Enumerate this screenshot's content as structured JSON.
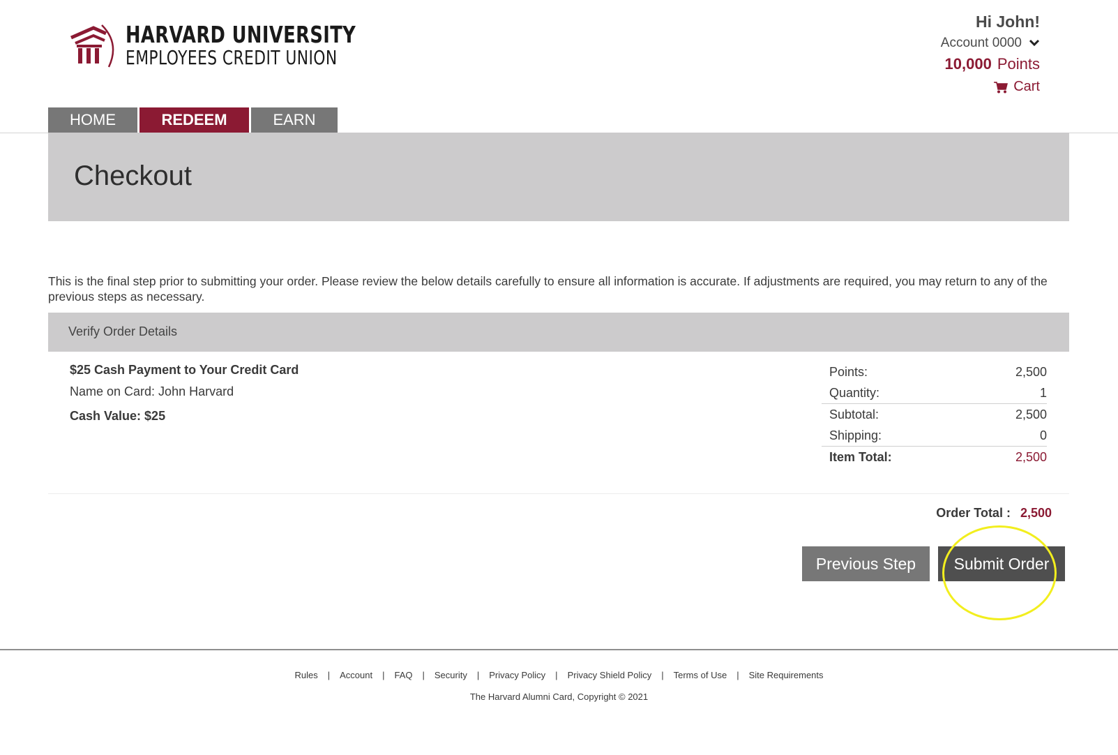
{
  "brand": {
    "line1": "HARVARD UNIVERSITY",
    "line2": "EMPLOYEES CREDIT UNION",
    "color": "#8b1a33"
  },
  "user": {
    "greeting": "Hi John!",
    "account_label": "Account 0000",
    "points_value": "10,000",
    "points_label": "Points",
    "cart_label": "Cart"
  },
  "nav": {
    "tabs": [
      {
        "label": "HOME",
        "active": false
      },
      {
        "label": "REDEEM",
        "active": true
      },
      {
        "label": "EARN",
        "active": false
      }
    ]
  },
  "page": {
    "title": "Checkout",
    "intro": "This is the final step prior to submitting your order. Please review the below details carefully to ensure all information is accurate. If adjustments are required, you may return to any of the previous steps as necessary."
  },
  "verify": {
    "header": "Verify Order Details",
    "item": {
      "title": "$25 Cash Payment to Your Credit Card",
      "name_on_card": "Name on Card: John Harvard",
      "cash_value": "Cash Value: $25"
    },
    "summary": [
      {
        "label": "Points:",
        "value": "2,500"
      },
      {
        "label": "Quantity:",
        "value": "1"
      },
      {
        "label": "Subtotal:",
        "value": "2,500"
      },
      {
        "label": "Shipping:",
        "value": "0"
      },
      {
        "label": "Item Total:",
        "value": "2,500"
      }
    ]
  },
  "order_total": {
    "label": "Order Total :",
    "value": "2,500"
  },
  "actions": {
    "previous_label": "Previous Step",
    "submit_label": "Submit Order"
  },
  "footer": {
    "links": [
      "Rules",
      "Account",
      "FAQ",
      "Security",
      "Privacy Policy",
      "Privacy Shield Policy",
      "Terms of Use",
      "Site Requirements"
    ],
    "separator": "|",
    "copyright": "The Harvard Alumni Card, Copyright © 2021"
  },
  "annotation_color": "#f2ee1e"
}
